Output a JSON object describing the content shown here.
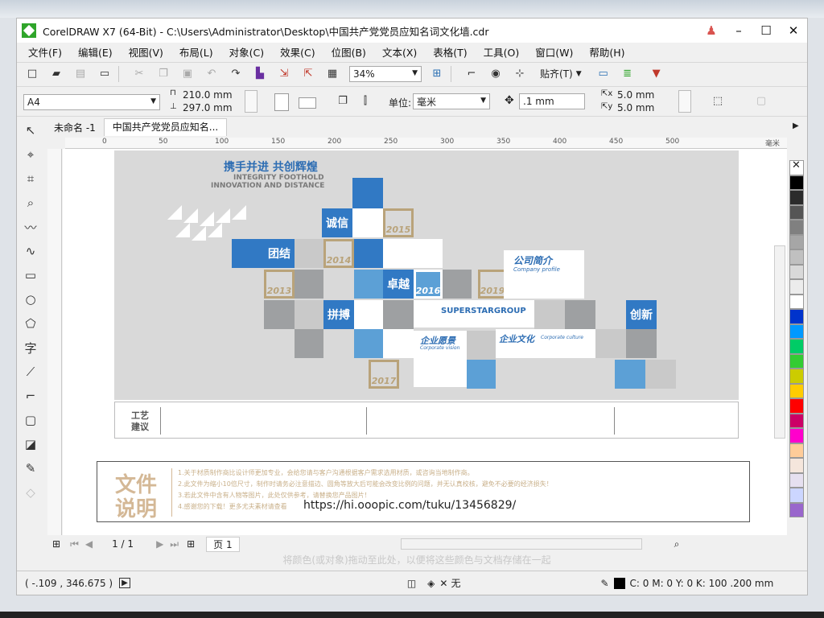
{
  "window": {
    "title": "CorelDRAW X7 (64-Bit) - C:\\Users\\Administrator\\Desktop\\中国共产党党员应知名词文化墙.cdr"
  },
  "menu": [
    "文件(F)",
    "编辑(E)",
    "视图(V)",
    "布局(L)",
    "对象(C)",
    "效果(C)",
    "位图(B)",
    "文本(X)",
    "表格(T)",
    "工具(O)",
    "窗口(W)",
    "帮助(H)"
  ],
  "toolbar": {
    "zoom": "34%",
    "snap_label": "贴齐(T)"
  },
  "propbar": {
    "paper_size": "A4",
    "width": "210.0 mm",
    "height": "297.0 mm",
    "unit_label": "单位:",
    "unit_value": "毫米",
    "nudge": ".1 mm",
    "dup_x": "5.0 mm",
    "dup_y": "5.0 mm"
  },
  "tabs": [
    {
      "label": "未命名 -1"
    },
    {
      "label": "中国共产党党员应知名..."
    }
  ],
  "ruler": {
    "ticks": [
      "0",
      "50",
      "100",
      "150",
      "200",
      "250",
      "300",
      "350",
      "400",
      "450",
      "500"
    ],
    "unit": "毫米"
  },
  "design": {
    "heading": "携手并进  共创辉煌",
    "sub1": "INTEGRITY FOOTHOLD",
    "sub2": "INNOVATION AND DISTANCE",
    "words": [
      "团结",
      "诚信",
      "拼搏",
      "卓越",
      "创新"
    ],
    "years": [
      "2013",
      "2014",
      "2015",
      "2016",
      "2017",
      "2019"
    ],
    "company_profile": "公司简介",
    "company_profile_en": "Company profile",
    "brand": "SUPERSTARGROUP",
    "vision": "企业愿景",
    "vision_en": "Corporate vision",
    "culture": "企业文化",
    "culture_en": "Corporate culture",
    "craft_title_1": "工艺",
    "craft_title_2": "建议"
  },
  "notes": {
    "title_1": "文件",
    "title_2": "说明",
    "line1": "1.关于材质制作商比设计师更加专业，会给您请与客户沟通根据客户需求选用材质，或咨询当地制作商。",
    "line2": "2.此文件为缩小10倍尺寸，制作时请务必注意描边、圆角等放大后可能会改变比例的问题，并无认真校核，避免不必要的经济损失！",
    "line3": "3.若此文件中含有人物等图片，此处仅供参考，请替换您产品图片！",
    "line4": "4.感谢您的下载！更多尤夫素材请查看",
    "url": "https://hi.ooopic.com/tuku/13456829/"
  },
  "pager": {
    "counter": "1 / 1",
    "page_label": "页 1"
  },
  "hint": "将颜色(或对象)拖动至此处，以便将这些颜色与文档存储在一起",
  "status": {
    "coords": "( -.109 , 346.675 )",
    "fill_none": "无",
    "outline": "C: 0 M: 0 Y: 0 K: 100  .200 mm"
  },
  "palette_colors": [
    "#000000",
    "#2b2b2b",
    "#555555",
    "#808080",
    "#a6a6a6",
    "#c0c0c0",
    "#d9d9d9",
    "#ececec",
    "#ffffff",
    "#0033cc",
    "#0099ff",
    "#00cc66",
    "#33cc33",
    "#cccc00",
    "#ffcc00",
    "#ff0000",
    "#cc0066",
    "#ff00cc",
    "#ffcc99",
    "#f5e6dc",
    "#e6e0f0",
    "#ccd6ff",
    "#b3b3ff",
    "#9966cc"
  ]
}
